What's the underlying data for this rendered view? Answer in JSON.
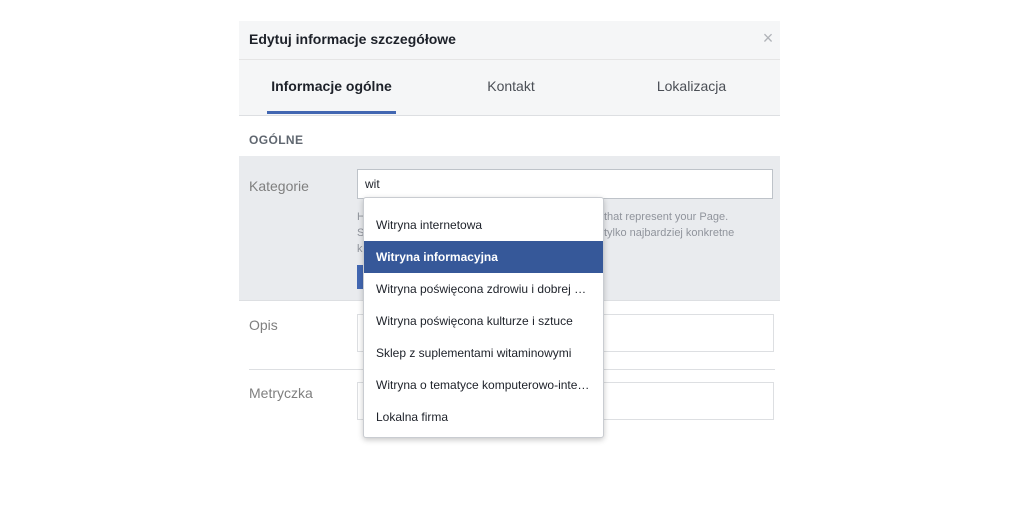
{
  "dialog": {
    "title": "Edytuj informacje szczegółowe",
    "close_symbol": "×"
  },
  "tabs": [
    {
      "label": "Informacje ogólne",
      "active": true
    },
    {
      "label": "Kontakt",
      "active": false
    },
    {
      "label": "Lokalizacja",
      "active": false
    }
  ],
  "section": {
    "title": "OGÓLNE"
  },
  "fields": {
    "category": {
      "label": "Kategorie",
      "value": "wit",
      "help_left": [
        "H",
        "S",
        "k"
      ],
      "help_right": [
        "that represent your Page.",
        "tylko najbardziej konkretne"
      ]
    },
    "description": {
      "label": "Opis"
    },
    "metric": {
      "label": "Metryczka"
    }
  },
  "dropdown": {
    "selected_index": 1,
    "items": [
      "Witryna internetowa",
      "Witryna informacyjna",
      "Witryna poświęcona zdrowiu i dobrej kondycji",
      "Witryna poświęcona kulturze i sztuce",
      "Sklep z suplementami witaminowymi",
      "Witryna o tematyce komputerowo-internetowej",
      "Lokalna firma"
    ]
  },
  "colors": {
    "accent": "#4267b2",
    "selected_bg": "#365899",
    "panel_bg": "#e9ebee"
  }
}
